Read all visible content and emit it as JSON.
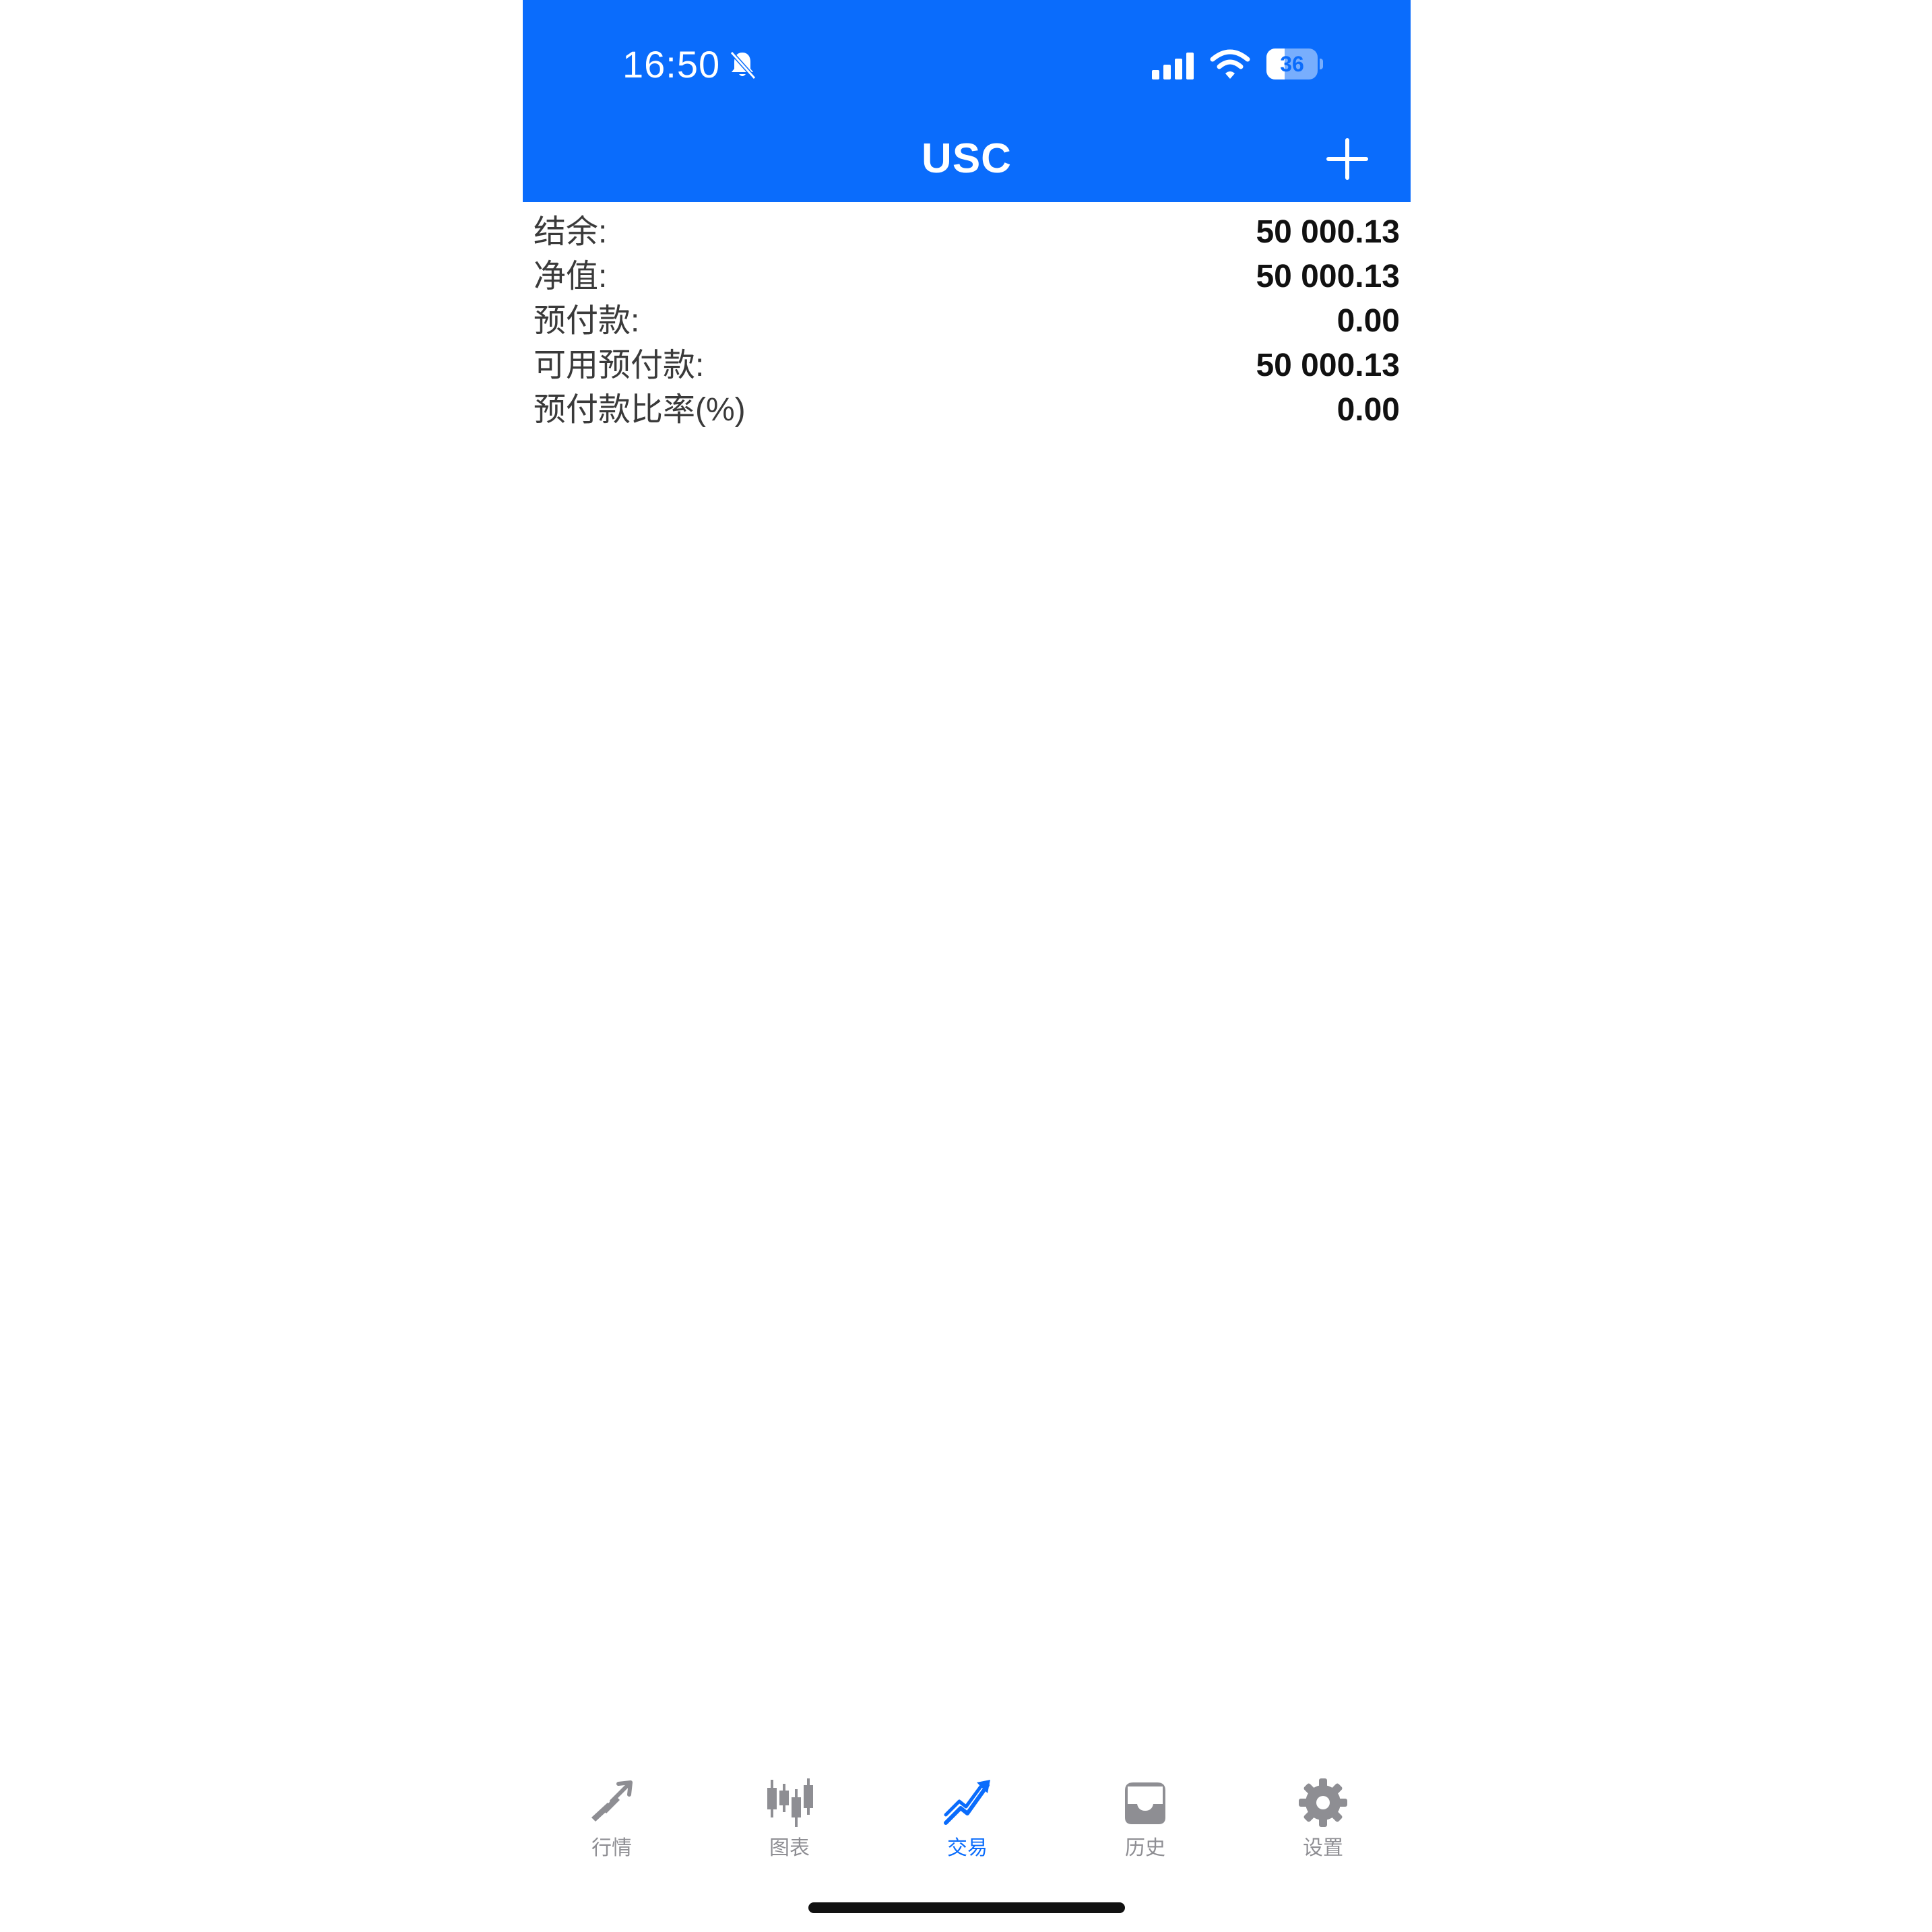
{
  "status_bar": {
    "time": "16:50",
    "battery_level": "36",
    "battery_fraction": 0.36
  },
  "header": {
    "title": "USC"
  },
  "account_summary": [
    {
      "label": "结余:",
      "value": "50 000.13"
    },
    {
      "label": "净值:",
      "value": "50 000.13"
    },
    {
      "label": "预付款:",
      "value": "0.00"
    },
    {
      "label": "可用预付款:",
      "value": "50 000.13"
    },
    {
      "label": "预付款比率(%)",
      "value": "0.00"
    }
  ],
  "tabs": [
    {
      "label": "行情",
      "icon": "quotes-icon",
      "active": false
    },
    {
      "label": "图表",
      "icon": "chart-icon",
      "active": false
    },
    {
      "label": "交易",
      "icon": "trade-icon",
      "active": true
    },
    {
      "label": "历史",
      "icon": "history-icon",
      "active": false
    },
    {
      "label": "设置",
      "icon": "settings-icon",
      "active": false
    }
  ],
  "colors": {
    "accent": "#0a6cfc",
    "inactive": "#8e8e93"
  }
}
